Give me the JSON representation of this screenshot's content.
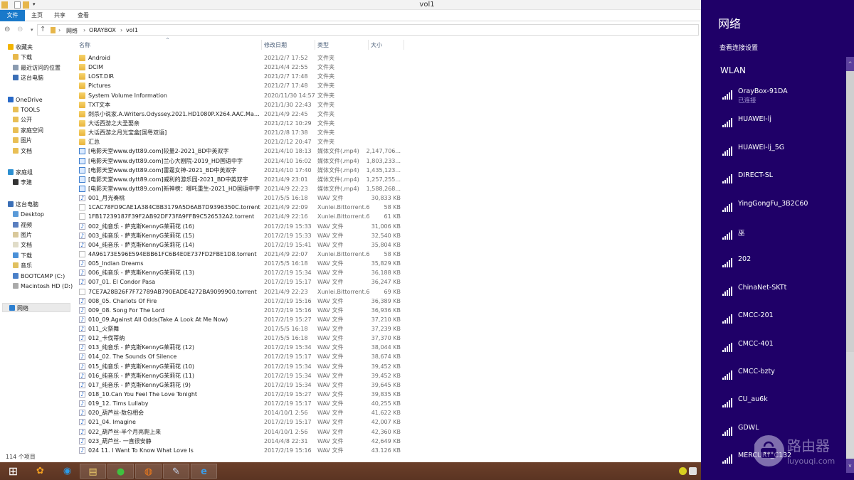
{
  "window": {
    "title": "vol1"
  },
  "ribbon": {
    "tabs": [
      "文件",
      "主页",
      "共享",
      "查看"
    ]
  },
  "address": {
    "crumbs": [
      "网络",
      "ORAYBOX",
      "vol1"
    ]
  },
  "columns": {
    "name": "名称",
    "date": "修改日期",
    "type": "类型",
    "size": "大小"
  },
  "sidebar": [
    {
      "label": "收藏夹",
      "level": 0,
      "color": "#f2b400"
    },
    {
      "label": "下载",
      "level": 1,
      "color": "#e8b84a"
    },
    {
      "label": "最近访问的位置",
      "level": 1,
      "color": "#8a9bb0"
    },
    {
      "label": "这台电脑",
      "level": 1,
      "color": "#3b6fb6"
    },
    {
      "label": "OneDrive",
      "level": 0,
      "color": "#2a6ac8",
      "gap": true
    },
    {
      "label": "TOOLS",
      "level": 1,
      "color": "#e9bf55"
    },
    {
      "label": "公开",
      "level": 1,
      "color": "#e9bf55"
    },
    {
      "label": "家庭空间",
      "level": 1,
      "color": "#e9bf55"
    },
    {
      "label": "图片",
      "level": 1,
      "color": "#e9bf55"
    },
    {
      "label": "文档",
      "level": 1,
      "color": "#e9bf55"
    },
    {
      "label": "家庭组",
      "level": 0,
      "color": "#2c8fd0",
      "gap": true
    },
    {
      "label": "李建",
      "level": 1,
      "color": "#333"
    },
    {
      "label": "这台电脑",
      "level": 0,
      "color": "#3b6fb6",
      "gap": true
    },
    {
      "label": "Desktop",
      "level": 1,
      "color": "#5a9ad8"
    },
    {
      "label": "视频",
      "level": 1,
      "color": "#5a7fc0"
    },
    {
      "label": "图片",
      "level": 1,
      "color": "#d9c89a"
    },
    {
      "label": "文档",
      "level": 1,
      "color": "#e0dcc8"
    },
    {
      "label": "下载",
      "level": 1,
      "color": "#4a90d8"
    },
    {
      "label": "音乐",
      "level": 1,
      "color": "#e0c060"
    },
    {
      "label": "BOOTCAMP (C:)",
      "level": 1,
      "color": "#4a80c8"
    },
    {
      "label": "Macintosh HD (D:)",
      "level": 1,
      "color": "#aaa"
    },
    {
      "label": "网络",
      "level": 0,
      "color": "#2c7fd0",
      "gap": true,
      "selected": true
    }
  ],
  "files": [
    {
      "name": "Android",
      "date": "2021/2/7 17:52",
      "type": "文件夹",
      "size": "",
      "icon": "folder"
    },
    {
      "name": "DCIM",
      "date": "2021/4/4 22:55",
      "type": "文件夹",
      "size": "",
      "icon": "folder"
    },
    {
      "name": "LOST.DIR",
      "date": "2021/2/7 17:48",
      "type": "文件夹",
      "size": "",
      "icon": "folder"
    },
    {
      "name": "Pictures",
      "date": "2021/2/7 17:48",
      "type": "文件夹",
      "size": "",
      "icon": "folder"
    },
    {
      "name": "System Volume Information",
      "date": "2020/11/30 14:57",
      "type": "文件夹",
      "size": "",
      "icon": "folder"
    },
    {
      "name": "TXT文本",
      "date": "2021/1/30 22:43",
      "type": "文件夹",
      "size": "",
      "icon": "folder"
    },
    {
      "name": "刺杀小说家.A.Writers.Odyssey.2021.HD1080P.X264.AAC.Mandarin...",
      "date": "2021/4/9 22:45",
      "type": "文件夹",
      "size": "",
      "icon": "folder"
    },
    {
      "name": "大话西游之大圣娶亲",
      "date": "2021/2/12 10:29",
      "type": "文件夹",
      "size": "",
      "icon": "folder"
    },
    {
      "name": "大话西游之月光宝盒[国粤双语]",
      "date": "2021/2/8 17:38",
      "type": "文件夹",
      "size": "",
      "icon": "folder"
    },
    {
      "name": "汇总",
      "date": "2021/2/12 20:47",
      "type": "文件夹",
      "size": "",
      "icon": "folder"
    },
    {
      "name": "[电影天堂www.dytt89.com]较量2-2021_BD中英双字",
      "date": "2021/4/10 18:13",
      "type": "媒体文件(.mp4)",
      "size": "2,147,706...",
      "icon": "video"
    },
    {
      "name": "[电影天堂www.dytt89.com]兰心大剧院-2019_HD国语中字",
      "date": "2021/4/10 16:02",
      "type": "媒体文件(.mp4)",
      "size": "1,803,233...",
      "icon": "video"
    },
    {
      "name": "[电影天堂www.dytt89.com]雷霆女神-2021_BD中英双字",
      "date": "2021/4/10 17:40",
      "type": "媒体文件(.mp4)",
      "size": "1,435,123...",
      "icon": "video"
    },
    {
      "name": "[电影天堂www.dytt89.com]威利的游乐园-2021_BD中英双字",
      "date": "2021/4/9 23:01",
      "type": "媒体文件(.mp4)",
      "size": "1,257,255...",
      "icon": "video"
    },
    {
      "name": "[电影天堂www.dytt89.com]新神榜：哪吒重生-2021_HD国语中字",
      "date": "2021/4/9 22:23",
      "type": "媒体文件(.mp4)",
      "size": "1,588,268...",
      "icon": "video"
    },
    {
      "name": "001_月光奏桃",
      "date": "2017/5/5 16:18",
      "type": "WAV 文件",
      "size": "30,833 KB",
      "icon": "audio"
    },
    {
      "name": "1CAC78FD9CAE1A384CBB3179A5D6AB7D9396350C.torrent",
      "date": "2021/4/9 22:09",
      "type": "Xunlei.Bittorrent.6",
      "size": "58 KB",
      "icon": "file"
    },
    {
      "name": "1FB17239187F39F2AB92DF73FA9FFB9C526532A2.torrent",
      "date": "2021/4/9 22:16",
      "type": "Xunlei.Bittorrent.6",
      "size": "61 KB",
      "icon": "file"
    },
    {
      "name": "002_纯音乐 - 萨克斯KennyG茉莉花 (16)",
      "date": "2017/2/19 15:33",
      "type": "WAV 文件",
      "size": "31,006 KB",
      "icon": "audio"
    },
    {
      "name": "003_纯音乐 - 萨克斯KennyG茉莉花 (15)",
      "date": "2017/2/19 15:33",
      "type": "WAV 文件",
      "size": "32,540 KB",
      "icon": "audio"
    },
    {
      "name": "004_纯音乐 - 萨克斯KennyG茉莉花 (14)",
      "date": "2017/2/19 15:41",
      "type": "WAV 文件",
      "size": "35,804 KB",
      "icon": "audio"
    },
    {
      "name": "4A96173E596E594EBB61FC6B4E0E737FD2FBE1D8.torrent",
      "date": "2021/4/9 22:07",
      "type": "Xunlei.Bittorrent.6",
      "size": "58 KB",
      "icon": "file"
    },
    {
      "name": "005_Indian Dreams",
      "date": "2017/5/5 16:18",
      "type": "WAV 文件",
      "size": "35,829 KB",
      "icon": "audio"
    },
    {
      "name": "006_纯音乐 - 萨克斯KennyG茉莉花 (13)",
      "date": "2017/2/19 15:34",
      "type": "WAV 文件",
      "size": "36,188 KB",
      "icon": "audio"
    },
    {
      "name": "007_01. El Condor Pasa",
      "date": "2017/2/19 15:17",
      "type": "WAV 文件",
      "size": "36,247 KB",
      "icon": "audio"
    },
    {
      "name": "7CE7A28B26F7F72789AB790EADE4272BA9099900.torrent",
      "date": "2021/4/9 22:23",
      "type": "Xunlei.Bittorrent.6",
      "size": "69 KB",
      "icon": "file"
    },
    {
      "name": "008_05. Chariots Of Fire",
      "date": "2017/2/19 15:16",
      "type": "WAV 文件",
      "size": "36,389 KB",
      "icon": "audio"
    },
    {
      "name": "009_08. Song For The Lord",
      "date": "2017/2/19 15:16",
      "type": "WAV 文件",
      "size": "36,936 KB",
      "icon": "audio"
    },
    {
      "name": "010_09.Against All Odds(Take A Look At Me Now)",
      "date": "2017/2/19 15:27",
      "type": "WAV 文件",
      "size": "37,210 KB",
      "icon": "audio"
    },
    {
      "name": "011_火祭舞",
      "date": "2017/5/5 16:18",
      "type": "WAV 文件",
      "size": "37,239 KB",
      "icon": "audio"
    },
    {
      "name": "012_卡伐蒂纳",
      "date": "2017/5/5 16:18",
      "type": "WAV 文件",
      "size": "37,370 KB",
      "icon": "audio"
    },
    {
      "name": "013_纯音乐 - 萨克斯KennyG茉莉花 (12)",
      "date": "2017/2/19 15:34",
      "type": "WAV 文件",
      "size": "38,044 KB",
      "icon": "audio"
    },
    {
      "name": "014_02. The Sounds Of Silence",
      "date": "2017/2/19 15:17",
      "type": "WAV 文件",
      "size": "38,674 KB",
      "icon": "audio"
    },
    {
      "name": "015_纯音乐 - 萨克斯KennyG茉莉花 (10)",
      "date": "2017/2/19 15:34",
      "type": "WAV 文件",
      "size": "39,452 KB",
      "icon": "audio"
    },
    {
      "name": "016_纯音乐 - 萨克斯KennyG茉莉花 (11)",
      "date": "2017/2/19 15:34",
      "type": "WAV 文件",
      "size": "39,452 KB",
      "icon": "audio"
    },
    {
      "name": "017_纯音乐 - 萨克斯KennyG茉莉花 (9)",
      "date": "2017/2/19 15:34",
      "type": "WAV 文件",
      "size": "39,645 KB",
      "icon": "audio"
    },
    {
      "name": "018_10.Can You Feel The Love Tonight",
      "date": "2017/2/19 15:27",
      "type": "WAV 文件",
      "size": "39,835 KB",
      "icon": "audio"
    },
    {
      "name": "019_12. Tims Lullaby",
      "date": "2017/2/19 15:17",
      "type": "WAV 文件",
      "size": "40,255 KB",
      "icon": "audio"
    },
    {
      "name": "020_葫芦丝-敖包相会",
      "date": "2014/10/1 2:56",
      "type": "WAV 文件",
      "size": "41,622 KB",
      "icon": "audio"
    },
    {
      "name": "021_04. Imagine",
      "date": "2017/2/19 15:17",
      "type": "WAV 文件",
      "size": "42,007 KB",
      "icon": "audio"
    },
    {
      "name": "022_葫芦丝-半个月亮爬上来",
      "date": "2014/10/1 2:56",
      "type": "WAV 文件",
      "size": "42,360 KB",
      "icon": "audio"
    },
    {
      "name": "023_葫芦丝- 一直很安静",
      "date": "2014/4/8 22:31",
      "type": "WAV 文件",
      "size": "42,649 KB",
      "icon": "audio"
    },
    {
      "name": "024 11. I Want To Know What Love Is",
      "date": "2017/2/19 15:16",
      "type": "WAV 文件",
      "size": "43.126 KB",
      "icon": "audio"
    }
  ],
  "status": {
    "count": "114 个项目"
  },
  "network_panel": {
    "title": "网络",
    "link": "查看连接设置",
    "section": "WLAN",
    "networks": [
      {
        "ssid": "OrayBox-91DA",
        "status": "已连接"
      },
      {
        "ssid": "HUAWEI-lj"
      },
      {
        "ssid": "HUAWEI-lj_5G"
      },
      {
        "ssid": "DIRECT-SL"
      },
      {
        "ssid": "YingGongFu_3B2C60"
      },
      {
        "ssid": "巫"
      },
      {
        "ssid": "202"
      },
      {
        "ssid": "ChinaNet-SKTt"
      },
      {
        "ssid": "CMCC-201"
      },
      {
        "ssid": "CMCC-401"
      },
      {
        "ssid": "CMCC-bzty"
      },
      {
        "ssid": "CU_au6k"
      },
      {
        "ssid": "GDWL"
      },
      {
        "ssid": "MERCURY_C132"
      }
    ],
    "bg_color": "#1f0068"
  },
  "watermark": {
    "text": "路由器",
    "url_text": "luyouqi.com"
  },
  "taskbar": {
    "icons": [
      "windows-start-icon",
      "app-store-icon",
      "qq-browser-icon",
      "file-explorer-icon",
      "wechat-icon",
      "firefox-icon",
      "paint-icon",
      "ie-icon"
    ]
  }
}
